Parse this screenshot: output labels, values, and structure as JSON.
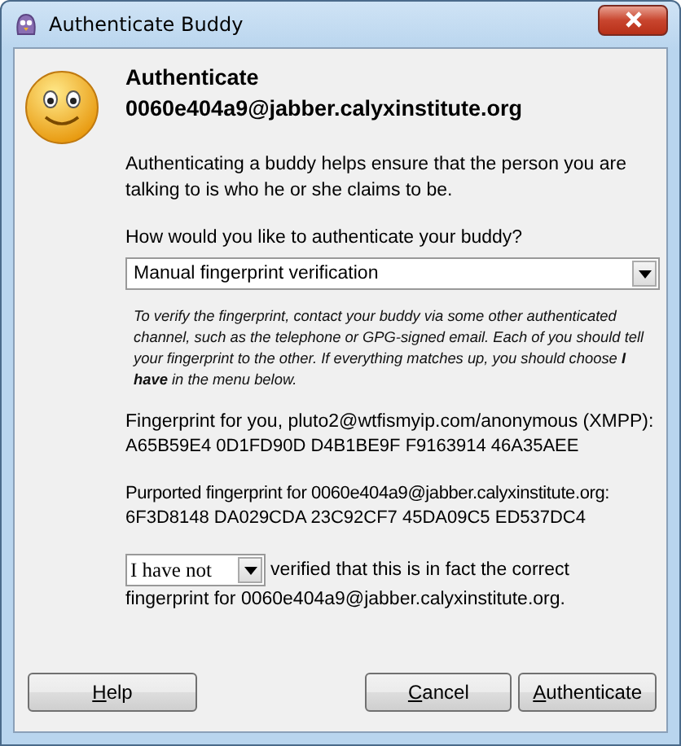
{
  "window": {
    "title": "Authenticate Buddy"
  },
  "heading": [
    "Authenticate",
    "0060e404a9@jabber.calyxinstitute.org"
  ],
  "intro": "Authenticating a buddy helps ensure that the person you are talking to is who he or she claims to be.",
  "method": {
    "label": "How would you like to authenticate your buddy?",
    "value": "Manual fingerprint verification"
  },
  "note": "To verify the fingerprint, contact your buddy via some other authenticated channel, such as the telephone or GPG-signed email.  Each of you should tell your fingerprint to the other. If everything matches up, you should choose **I have** in the menu below.",
  "own": {
    "label": "Fingerprint for you, pluto2@wtfismyip.com/anonymous (XMPP):",
    "value": "A65B59E4 0D1FD90D D4B1BE9F F9163914 46A35AEE"
  },
  "buddy": {
    "label": "Purported fingerprint for 0060e404a9@jabber.calyxinstitute.org:",
    "value": "6F3D8148 DA029CDA 23C92CF7 45DA09C5 ED537DC4"
  },
  "verify": {
    "value": "I have not",
    "text": "verified that this is in fact the correct",
    "text_2": "fingerprint for 0060e404a9@jabber.calyxinstitute.org."
  },
  "help_button": "Help",
  "buttons": [
    "Cancel",
    "Authenticate"
  ]
}
